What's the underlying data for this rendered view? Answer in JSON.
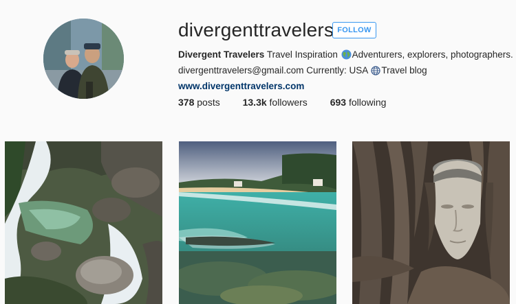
{
  "profile": {
    "username": "divergenttravelers",
    "follow_label": "FOLLOW",
    "full_name": "Divergent Travelers",
    "bio_line1": "Travel Inspiration",
    "bio_line1b": "Adventurers, explorers, photographers.",
    "bio_line2a": "divergenttravelers@gmail.com Currently: USA",
    "bio_line2b": "Travel blog",
    "website": "www.divergenttravelers.com"
  },
  "stats": {
    "posts_count": "378",
    "posts_label": "posts",
    "followers_count": "13.3k",
    "followers_label": "followers",
    "following_count": "693",
    "following_label": "following"
  },
  "icons": {
    "avatar": "profile-photo",
    "earth_emoji": "globe-earth-icon",
    "globe_meridians": "globe-meridians-icon",
    "missing_glyph": "missing-glyph-icon"
  },
  "posts": [
    {
      "subject": "waterfall"
    },
    {
      "subject": "beach"
    },
    {
      "subject": "buddha-head-in-tree"
    }
  ],
  "colors": {
    "accent": "#3897f0",
    "link": "#003569",
    "background": "#fafafa"
  }
}
